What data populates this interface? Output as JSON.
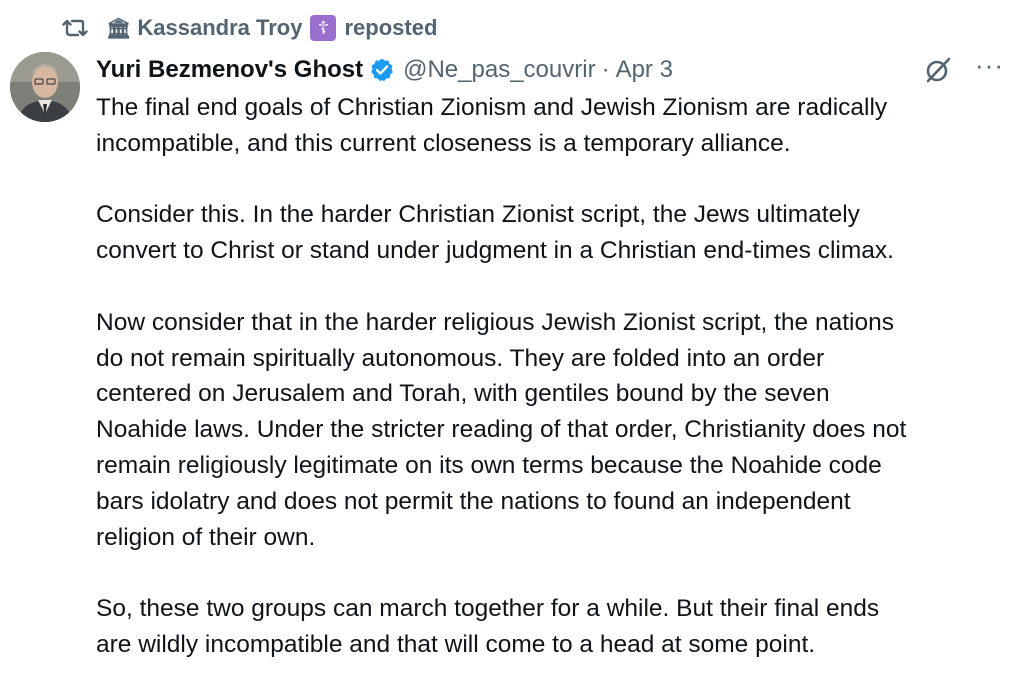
{
  "repost": {
    "user": "Kassandra Troy",
    "emoji_before": "🏛",
    "badge": "☦",
    "label": "reposted"
  },
  "author": {
    "display_name": "Yuri Bezmenov's Ghost",
    "handle": "@Ne_pas_couvrir",
    "separator": "·",
    "date": "Apr 3"
  },
  "icons": {
    "repost": "repost-icon",
    "verified": "verified-badge-icon",
    "grok": "grok-icon",
    "more": "more-icon"
  },
  "more_label": "···",
  "colors": {
    "verified": "#1d9bf0",
    "secondary_text": "#536471",
    "text": "#0f1419",
    "badge_purple": "#9b6fce"
  },
  "body": {
    "paragraphs": [
      "The final end goals of Christian Zionism and Jewish Zionism are radically\nincompatible, and this current closeness is a temporary alliance.",
      "Consider this. In the harder Christian Zionist script, the Jews ultimately\nconvert to Christ or stand under judgment in a Christian end-times climax.",
      "Now consider that in the harder religious Jewish Zionist script, the nations\ndo not remain spiritually autonomous. They are folded into an order\ncentered on Jerusalem and Torah, with gentiles bound by the seven\nNoahide laws. Under the stricter reading of that order, Christianity does not\nremain religiously legitimate on its own terms because the Noahide code\nbars idolatry and does not permit the nations to found an independent\nreligion of their own.",
      "So, these two groups can march together for a while. But their final ends\nare wildly incompatible and that will come to a head at some point."
    ]
  }
}
